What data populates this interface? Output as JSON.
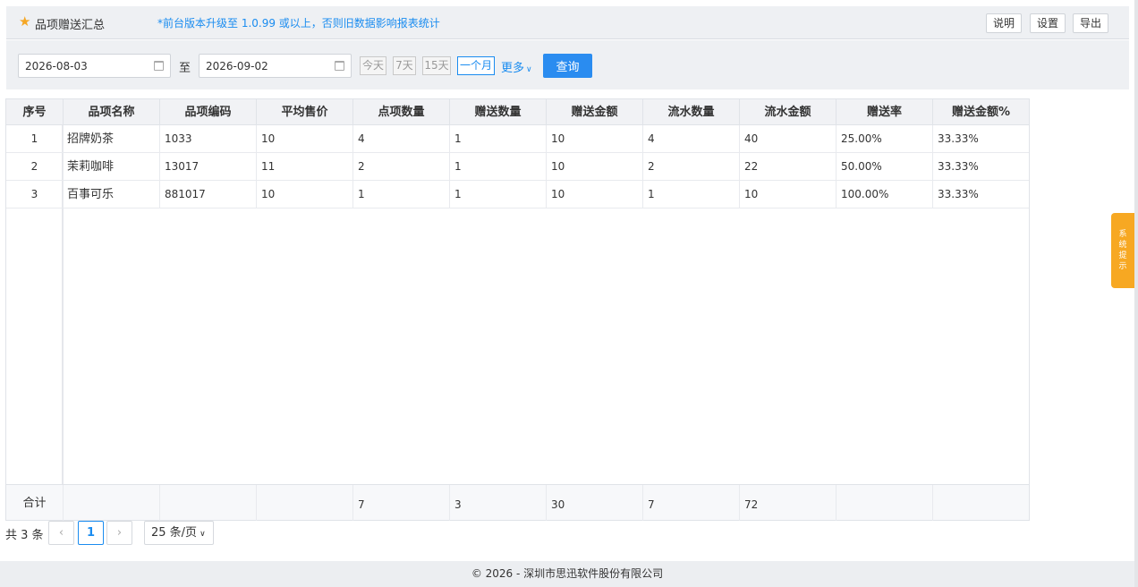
{
  "header": {
    "title": "品项赠送汇总",
    "notice": "*前台版本升级至 1.0.99 或以上，否则旧数据影响报表统计",
    "buttons": {
      "explain": "说明",
      "settings": "设置",
      "export": "导出"
    }
  },
  "filter": {
    "start_date": "2026-08-03",
    "to_label": "至",
    "end_date": "2026-09-02",
    "quick": {
      "today": "今天",
      "week": "7天",
      "half_month": "15天",
      "month": "一个月"
    },
    "more": "更多",
    "search": "查询"
  },
  "table": {
    "headers": [
      "序号",
      "品项名称",
      "品项编码",
      "平均售价",
      "点项数量",
      "赠送数量",
      "赠送金额",
      "流水数量",
      "流水金额",
      "赠送率",
      "赠送金额%"
    ],
    "rows": [
      [
        "1",
        "招牌奶茶",
        "1033",
        "10",
        "4",
        "1",
        "10",
        "4",
        "40",
        "25.00%",
        "33.33%"
      ],
      [
        "2",
        "茉莉咖啡",
        "13017",
        "11",
        "2",
        "1",
        "10",
        "2",
        "22",
        "50.00%",
        "33.33%"
      ],
      [
        "3",
        "百事可乐",
        "881017",
        "10",
        "1",
        "1",
        "10",
        "1",
        "10",
        "100.00%",
        "33.33%"
      ]
    ],
    "footer": [
      "合计",
      "",
      "",
      "",
      "7",
      "3",
      "30",
      "7",
      "72",
      "",
      ""
    ]
  },
  "pagination": {
    "total": "共 3 条",
    "prev": "‹",
    "current": "1",
    "next": "›",
    "page_size": "25 条/页"
  },
  "footer": {
    "copyright": "© 2026 - 深圳市思迅软件股份有限公司"
  },
  "side_tab": {
    "label": "系统提示"
  },
  "colors": {
    "accent": "#2a8cf0",
    "side_tab": "#f7a822",
    "star": "#f5a623"
  }
}
